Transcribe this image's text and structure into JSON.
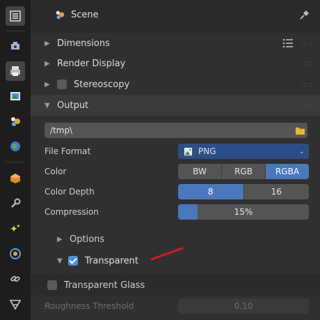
{
  "header": {
    "title": "Scene"
  },
  "panels": {
    "dimensions": "Dimensions",
    "render_display": "Render Display",
    "stereoscopy": "Stereoscopy",
    "output": "Output"
  },
  "output": {
    "path": "/tmp\\",
    "file_format_label": "File Format",
    "file_format_value": "PNG",
    "color_label": "Color",
    "color_options": [
      "BW",
      "RGB",
      "RGBA"
    ],
    "color_selected": "RGBA",
    "color_depth_label": "Color Depth",
    "color_depth_options": [
      "8",
      "16"
    ],
    "color_depth_selected": "8",
    "compression_label": "Compression",
    "compression_value": "15%",
    "compression_fraction": 0.15,
    "options_label": "Options",
    "transparent_label": "Transparent",
    "transparent_checked": true,
    "transparent_glass_label": "Transparent Glass",
    "transparent_glass_checked": false,
    "roughness_label": "Roughness Threshold",
    "roughness_value": "0.10"
  },
  "colors": {
    "accent": "#4a78bd",
    "annotation": "#e0141e"
  },
  "tabs": [
    "tool",
    "render",
    "output",
    "view-layer",
    "scene",
    "world",
    "object",
    "modifier",
    "particles",
    "physics",
    "constraints",
    "data"
  ]
}
